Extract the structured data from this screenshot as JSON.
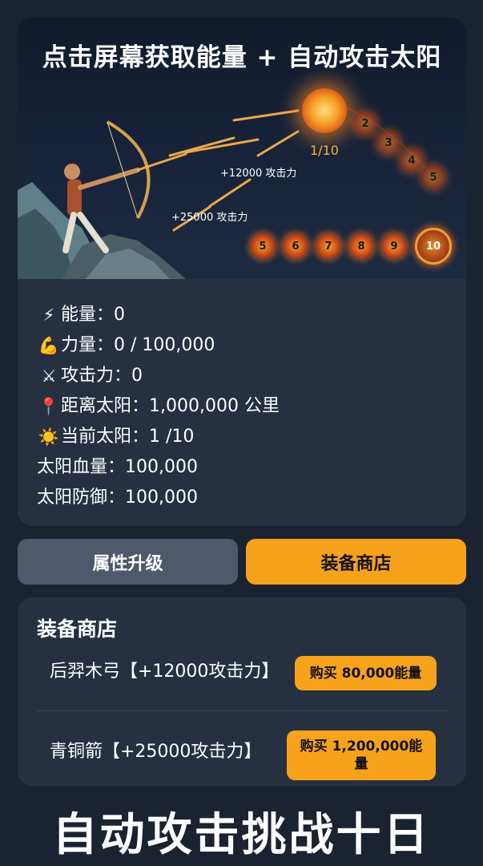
{
  "scene": {
    "title": "点击屏幕获取能量 + 自动攻击太阳",
    "progress_label": "1/10",
    "damage_labels": [
      "+12000 攻击力",
      "+25000 攻击力"
    ],
    "sun_badges": [
      "2",
      "3",
      "4",
      "5",
      "5",
      "6",
      "7",
      "8",
      "9",
      "10"
    ]
  },
  "stats": [
    {
      "icon": "⚡",
      "icon_name": "lightning-icon",
      "text": "能量：0"
    },
    {
      "icon": "💪",
      "icon_name": "muscle-icon",
      "text": "力量：0 / 100,000"
    },
    {
      "icon": "⚔",
      "icon_name": "crossed-swords-icon",
      "text": "攻击力：0"
    },
    {
      "icon": "📍",
      "icon_name": "pin-icon",
      "text": "距离太阳：1,000,000 公里"
    },
    {
      "icon": "☀️",
      "icon_name": "sun-icon",
      "text": "当前太阳：1 /10"
    },
    {
      "icon": "",
      "icon_name": "",
      "text": "太阳血量：100,000"
    },
    {
      "icon": "",
      "icon_name": "",
      "text": "太阳防御：100,000"
    }
  ],
  "tabs": {
    "attributes": "属性升级",
    "shop": "装备商店"
  },
  "shop": {
    "title": "装备商店",
    "items": [
      {
        "name": "后羿木弓【+12000攻击力】",
        "buy": "购买 80,000能量"
      },
      {
        "name": "青铜箭【+25000攻击力】",
        "buy": "购买 1,200,000能量"
      }
    ]
  },
  "footer": {
    "text": "自动攻击挑战十日"
  },
  "colors": {
    "background": "#1b2230",
    "card": "#263040",
    "accent": "#f7a21b",
    "tab_inactive": "#4f596b"
  }
}
